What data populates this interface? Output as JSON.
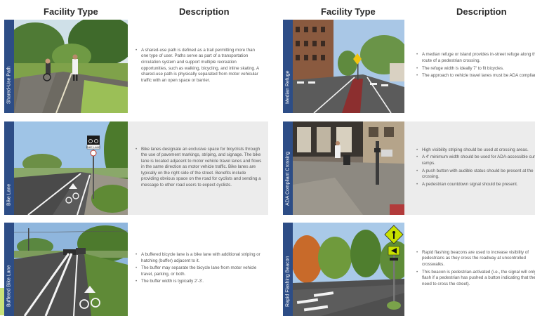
{
  "headers": {
    "left_facility": "Facility Type",
    "left_description": "Description",
    "right_facility": "Facility Type",
    "right_description": "Description"
  },
  "left_rows": [
    {
      "label": "Shared-Use Path",
      "bullets": [
        "A shared-use path is defined as a trail permitting more than one type of user. Paths serve as part of a transportation circulation system and support multiple recreation opportunities, such as walking, bicycling, and inline skating. A shared-use path is physically separated from motor vehicular traffic with an open space or barrier."
      ]
    },
    {
      "label": "Bike Lane",
      "bullets": [
        "Bike lanes designate an exclusive space for bicyclists through the use of pavement markings, striping, and signage. The bike lane is located adjacent to motor vehicle travel lanes and flows in the same direction as motor vehicle traffic. Bike lanes are typically on the right side of the street. Benefits include providing obvious space on the road for cyclists and sending a message to other road users to expect cyclists."
      ],
      "sign_text": "BIKE LANE"
    },
    {
      "label": "Buffered Bike Lane",
      "bullets": [
        "A buffered bicycle lane is a bike lane with additional striping or hatching (buffer) adjacent to it.",
        "The buffer may separate the bicycle lane from motor vehicle travel, parking, or both.",
        "The buffer width is typically 2'-3'."
      ]
    }
  ],
  "right_rows": [
    {
      "label": "Median Refuge",
      "bullets": [
        "A median refuge or island provides in-street refuge along the route of a pedestrian crossing.",
        "The refuge width is ideally 7' to fit bicycles.",
        "The approach to vehicle travel lanes must be ADA compliant."
      ]
    },
    {
      "label": "ADA Compliant Crossing",
      "bullets": [
        "High visibility striping should be used at crossing areas.",
        "A 4' minimum width should be used for ADA-accessible curb ramps.",
        "A push button with audible status should be present at the crossing.",
        "A pedestrian countdown signal should be present."
      ]
    },
    {
      "label": "Rapid Flashing Beacon",
      "bullets": [
        "Rapid flashing beacons are used to increase visibility of pedestrians as they cross the roadway at uncontrolled crosswalks.",
        "This beacon is pedestrian-activated (i.e., the signal will only flash if a pedestrian has pushed a button indicating that they need to cross the street)."
      ]
    }
  ]
}
